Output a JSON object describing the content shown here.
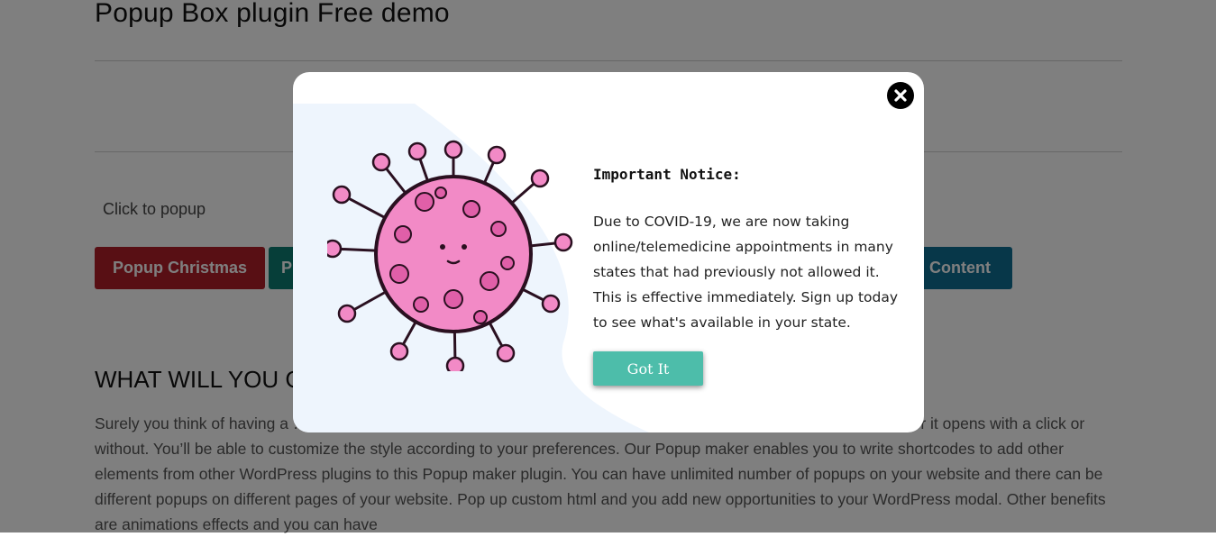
{
  "page": {
    "title": "Popup Box plugin Free demo",
    "click_label": "Click to popup",
    "buttons": {
      "christmas": "Popup Christmas",
      "second": "P",
      "content": "n Content"
    },
    "section_heading": "WHAT WILL YOU G",
    "body_text": "Surely you think of having a … er devices used by the visitors. Our Popup maker has the opportunity to control whether it opens with a click or without. You’ll be able to customize the style according to your preferences. Our Popup maker enables you to write shortcodes to add other elements from other WordPress plugins to this Popup maker plugin. You can have unlimited number of popups on your website and there can be different popups on different pages of your website. Pop up custom html and you add new opportunities to your WordPress modal. Other benefits are animations effects and you can have"
  },
  "modal": {
    "notice_title": "Important Notice:",
    "notice_body": "Due to COVID-19, we are now taking online/telemedicine appointments in many states that had previously not allowed it. This is effective immediately. Sign up today to see what's available in your state.",
    "got_it_label": "Got It",
    "close_icon": "close-icon",
    "illustration": "virus-illustration"
  },
  "colors": {
    "overlay": "rgba(0,0,0,0.5)",
    "got_it": "#4dbdaa",
    "christmas_button": "#b01f29",
    "content_button": "#0e6f92",
    "virus_pink": "#f28ac6",
    "modal_blob": "#eef5fd"
  }
}
